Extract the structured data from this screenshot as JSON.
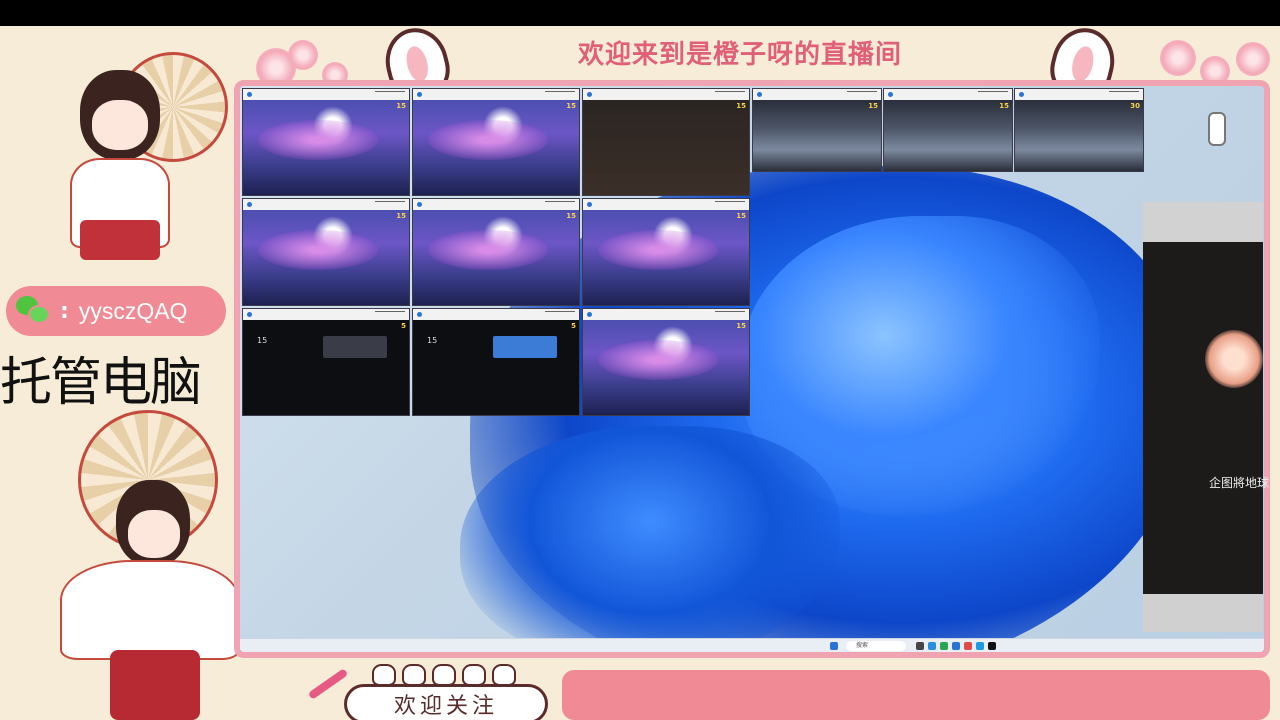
{
  "header": {
    "title": "欢迎来到是橙子呀的直播间"
  },
  "contact": {
    "wechat_id": "yysczQAQ",
    "separator": ":"
  },
  "label": {
    "hosting": "托管电脑"
  },
  "footer": {
    "follow": "欢迎关注"
  },
  "side_window": {
    "caption": "企图將地球"
  },
  "taskbar": {
    "search_placeholder": "搜索"
  },
  "game_windows": [
    {
      "scene": "night",
      "badge": "15"
    },
    {
      "scene": "night",
      "badge": "15"
    },
    {
      "scene": "shop",
      "badge": "15"
    },
    {
      "scene": "battle",
      "badge": "15"
    },
    {
      "scene": "battle",
      "badge": "15"
    },
    {
      "scene": "battle",
      "badge": "30"
    },
    {
      "scene": "night",
      "badge": "15"
    },
    {
      "scene": "night",
      "badge": "15"
    },
    {
      "scene": "night",
      "badge": "15"
    },
    {
      "scene": "menu",
      "badge": "5",
      "number": "15"
    },
    {
      "scene": "menu",
      "badge": "5",
      "number": "15"
    },
    {
      "scene": "night",
      "badge": "15"
    }
  ],
  "colors": {
    "accent_pink": "#f08b95",
    "title_pink": "#e0607a",
    "frame_border": "#f0a3b0",
    "wechat_green": "#4fc43f"
  }
}
